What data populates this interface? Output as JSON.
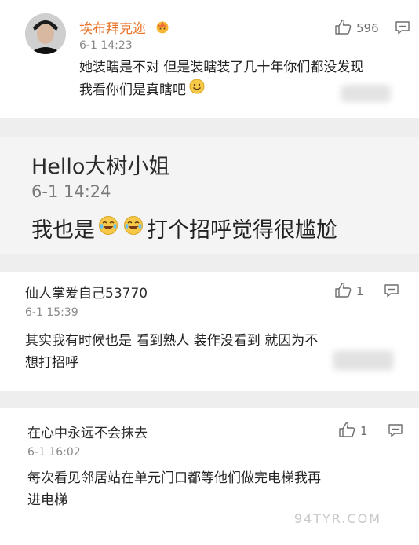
{
  "comments": [
    {
      "username": "埃布拜克迩",
      "timestamp": "6-1 14:23",
      "body_line1": "她装瞎是不对 但是装瞎装了几十年你们都没发现",
      "body_line2": "我看你们是真瞎吧",
      "likes": "596"
    },
    {
      "username": "Hello大树小姐",
      "timestamp": "6-1 14:24",
      "body_text1": "我也是",
      "body_text2": "打个招呼觉得很尴尬"
    },
    {
      "username": "仙人掌爱自己53770",
      "timestamp": "6-1 15:39",
      "body_line1": "其实我有时候也是 看到熟人 装作没看到 就因为不",
      "body_line2": "想打招呼",
      "likes": "1"
    },
    {
      "username": "在心中永远不会抹去",
      "timestamp": "6-1 16:02",
      "body_line1": "每次看见邻居站在单元门口都等他们做完电梯我再",
      "body_line2": "进电梯",
      "likes": "1"
    }
  ],
  "watermark": "94TYR.COM",
  "colors": {
    "username_orange": "#e8742a",
    "background": "#eeeeee",
    "card": "#ffffff",
    "emoji_yellow": "#f7c948"
  },
  "icons": [
    "avatar",
    "crown-badge-icon",
    "thumbs-up-icon",
    "reply-icon",
    "smile-emoji-icon",
    "laugh-cry-emoji-icon"
  ]
}
